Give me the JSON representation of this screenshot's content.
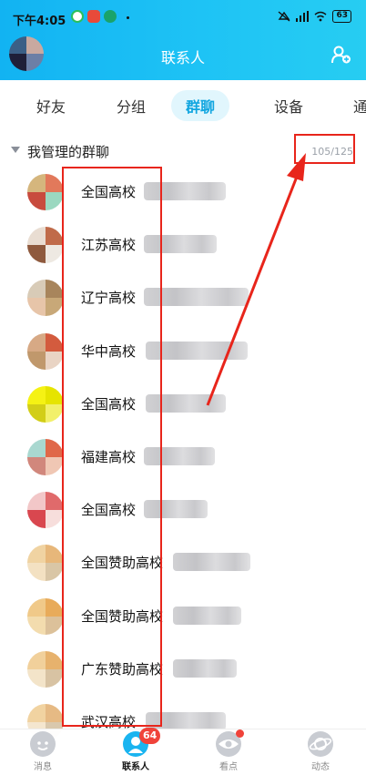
{
  "status_bar": {
    "time": "下午4:05",
    "battery": "63"
  },
  "header": {
    "title": "联系人"
  },
  "tabs": [
    {
      "label": "好友",
      "active": false
    },
    {
      "label": "分组",
      "active": false
    },
    {
      "label": "群聊",
      "active": true
    },
    {
      "label": "设备",
      "active": false
    },
    {
      "label": "通",
      "active": false
    }
  ],
  "group": {
    "title": "我管理的群聊",
    "count": "105/125"
  },
  "groups": [
    {
      "name": "全国高校",
      "colors": [
        "#d5b67d",
        "#e2795b",
        "#c84b3e",
        "#9bd8c0"
      ]
    },
    {
      "name": "江苏高校",
      "colors": [
        "#e9ddd2",
        "#c06b4a",
        "#8f5a3e",
        "#eee9e2"
      ]
    },
    {
      "name": "辽宁高校",
      "colors": [
        "#d8cbb7",
        "#a8855c",
        "#e7c5a9",
        "#c8a878"
      ]
    },
    {
      "name": "华中高校",
      "colors": [
        "#d7a985",
        "#d35b3e",
        "#c0986c",
        "#e9d4c4"
      ]
    },
    {
      "name": "全国高校",
      "colors": [
        "#f5f214",
        "#e6e400",
        "#d2ce17",
        "#f2f06a"
      ]
    },
    {
      "name": "福建高校",
      "colors": [
        "#a9d8d0",
        "#e06849",
        "#d1877c",
        "#f0c7b4"
      ]
    },
    {
      "name": "全国高校",
      "colors": [
        "#f2c7c8",
        "#e06a6b",
        "#d9474f",
        "#f7dedc"
      ]
    },
    {
      "name": "全国赞助高校",
      "colors": [
        "#f0d3a2",
        "#e7b77a",
        "#f3e1c2",
        "#d9c6a6"
      ]
    },
    {
      "name": "全国赞助高校",
      "colors": [
        "#f0c989",
        "#e8ab5a",
        "#f3dcae",
        "#dcc19a"
      ]
    },
    {
      "name": "广东赞助高校",
      "colors": [
        "#f1d09b",
        "#e7b26d",
        "#f3e4c9",
        "#d8c3a3"
      ]
    },
    {
      "name": "武汉高校",
      "colors": [
        "#f1d3a1",
        "#e6ba84",
        "#f4e6cf",
        "#d9c8ad"
      ]
    }
  ],
  "bottom_nav": [
    {
      "label": "消息",
      "icon": "message-icon",
      "active": false
    },
    {
      "label": "联系人",
      "icon": "contacts-icon",
      "active": true,
      "badge": "64"
    },
    {
      "label": "看点",
      "icon": "watch-icon",
      "active": false,
      "dot": true
    },
    {
      "label": "动态",
      "icon": "feed-icon",
      "active": false
    }
  ],
  "colors": {
    "accent": "#12a6e0",
    "annotation": "#e8251b"
  }
}
